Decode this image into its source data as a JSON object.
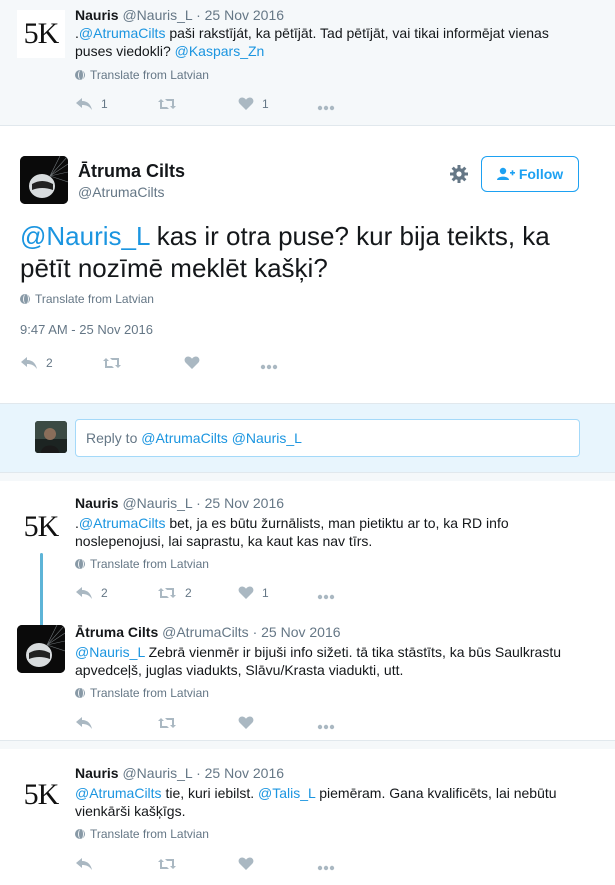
{
  "tweet1": {
    "name": "Nauris",
    "handle": "@Nauris_L",
    "date": "· 25 Nov 2016",
    "body_prefix": ".",
    "m1": "@AtrumaCilts",
    "body_mid": " paši rakstīját, ka pētījāt. Tad pētījāt, vai tikai informējat vienas puses viedokli? ",
    "m2": "@Kaspars_Zn",
    "translate": "Translate from Latvian",
    "reply_count": "1",
    "retweet_count": "",
    "like_count": "1"
  },
  "main": {
    "name": "Ātruma Cilts",
    "handle": "@AtrumaCilts",
    "follow_label": "Follow",
    "mention": "@Nauris_L",
    "text": " kas ir otra puse? kur bija teikts, ka pētīt nozīmē meklēt kašķi?",
    "translate": "Translate from Latvian",
    "timestamp": "9:47 AM - 25 Nov 2016",
    "reply_count": "2"
  },
  "reply_box": {
    "prefix": "Reply to ",
    "mentions": "@AtrumaCilts @Nauris_L"
  },
  "tweet3": {
    "name": "Nauris",
    "handle": "@Nauris_L",
    "date": "· 25 Nov 2016",
    "body_prefix": ".",
    "m1": "@AtrumaCilts",
    "body_rest": " bet, ja es būtu žurnālists, man pietiktu ar to, ka RD info noslepenojusi, lai saprastu, ka kaut kas nav tīrs.",
    "translate": "Translate from Latvian",
    "reply_count": "2",
    "retweet_count": "2",
    "like_count": "1"
  },
  "tweet4": {
    "name": "Ātruma Cilts",
    "handle": "@AtrumaCilts",
    "date": "· 25 Nov 2016",
    "m1": "@Nauris_L",
    "body_rest": " Zebrā vienmēr ir bijuši info sižeti. tā tika stāstīts, ka būs Saulkrastu apvedceļš, juglas viadukts, Slāvu/Krasta viadukti, utt.",
    "translate": "Translate from Latvian"
  },
  "tweet5": {
    "name": "Nauris",
    "handle": "@Nauris_L",
    "date": "· 25 Nov 2016",
    "m1": "@AtrumaCilts",
    "body_mid": " tie, kuri iebilst. ",
    "m2": "@Talis_L",
    "body_rest": " piemēram. Gana kvalificēts, lai nebūtu vienkārši kašķīgs.",
    "translate": "Translate from Latvian"
  },
  "icons": [
    "reply-icon",
    "retweet-icon",
    "heart-icon",
    "more-icon",
    "gear-icon",
    "follow-person-icon",
    "globe-icon"
  ],
  "colors": {
    "link": "#1b95e0",
    "follow": "#1da1f2",
    "thread_line": "#5db4d7",
    "muted": "#657786"
  }
}
